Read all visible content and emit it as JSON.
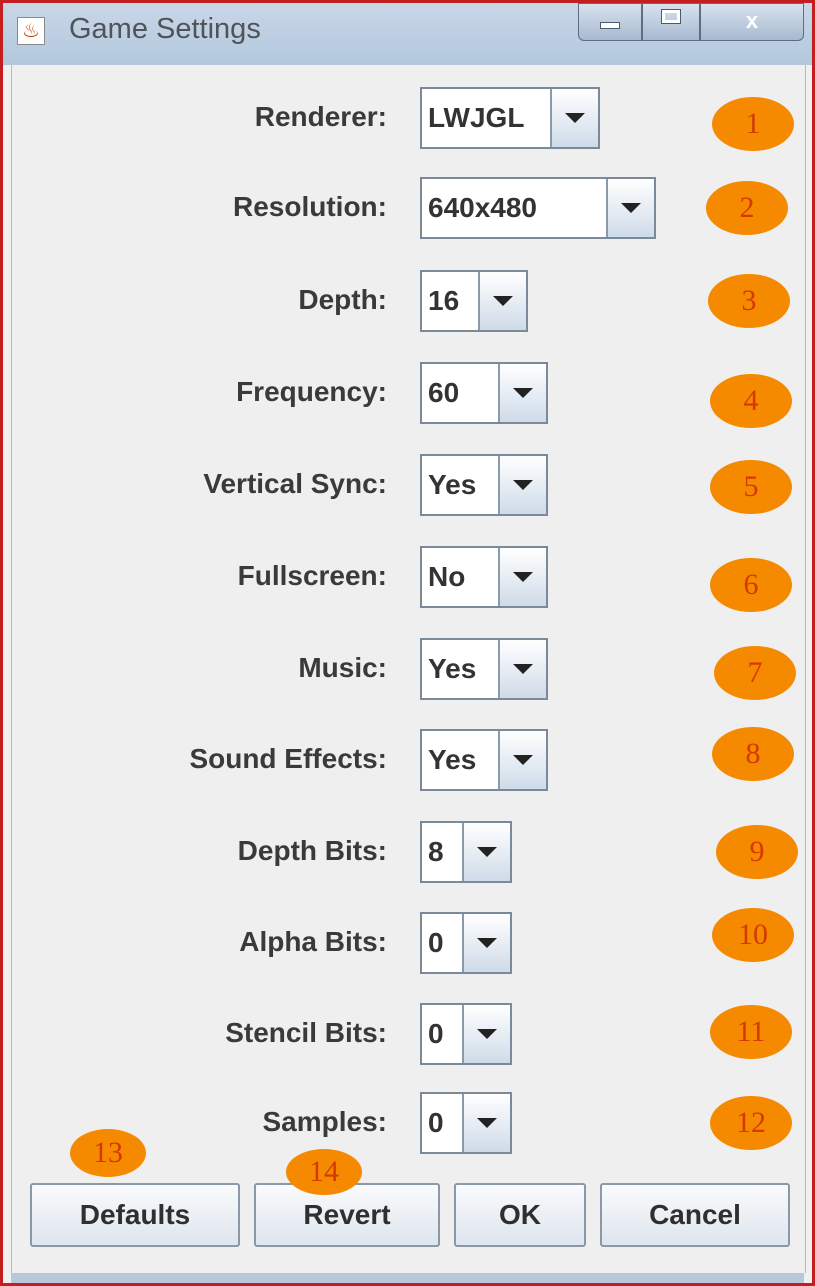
{
  "window": {
    "title": "Game Settings",
    "close_label": "x"
  },
  "settings": [
    {
      "label": "Renderer:",
      "value": "LWJGL",
      "badge": "1"
    },
    {
      "label": "Resolution:",
      "value": "640x480",
      "badge": "2"
    },
    {
      "label": "Depth:",
      "value": "16",
      "badge": "3"
    },
    {
      "label": "Frequency:",
      "value": "60",
      "badge": "4"
    },
    {
      "label": "Vertical Sync:",
      "value": "Yes",
      "badge": "5"
    },
    {
      "label": "Fullscreen:",
      "value": "No",
      "badge": "6"
    },
    {
      "label": "Music:",
      "value": "Yes",
      "badge": "7"
    },
    {
      "label": "Sound Effects:",
      "value": "Yes",
      "badge": "8"
    },
    {
      "label": "Depth Bits:",
      "value": "8",
      "badge": "9"
    },
    {
      "label": "Alpha Bits:",
      "value": "0",
      "badge": "10"
    },
    {
      "label": "Stencil Bits:",
      "value": "0",
      "badge": "11"
    },
    {
      "label": "Samples:",
      "value": "0",
      "badge": "12"
    }
  ],
  "buttons": {
    "defaults": "Defaults",
    "revert": "Revert",
    "ok": "OK",
    "cancel": "Cancel",
    "defaults_badge": "13",
    "revert_badge": "14"
  },
  "colors": {
    "badge": "#f58a00",
    "badge_text": "#d43a00",
    "window_border": "#c41f1f"
  }
}
